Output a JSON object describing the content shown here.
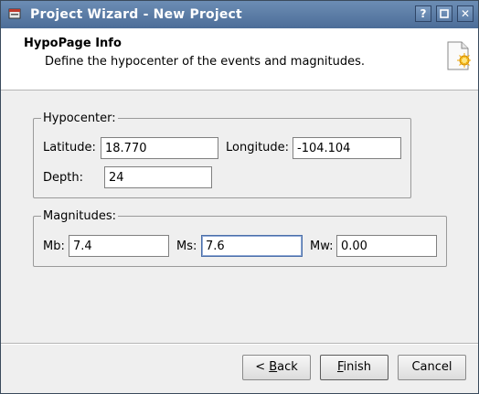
{
  "window": {
    "title": "Project Wizard - New Project",
    "help_btn": "?",
    "close_btn": "✕"
  },
  "header": {
    "title": "HypoPage Info",
    "subtitle": "Define the hypocenter of the events and magnitudes."
  },
  "hypocenter": {
    "legend": "Hypocenter:",
    "latitude_label": "Latitude:",
    "latitude_value": "18.770",
    "longitude_label": "Longitude:",
    "longitude_value": "-104.104",
    "depth_label": "Depth:",
    "depth_value": "24"
  },
  "magnitudes": {
    "legend": "Magnitudes:",
    "mb_label": "Mb:",
    "mb_value": "7.4",
    "ms_label": "Ms:",
    "ms_value": "7.6",
    "mw_label": "Mw:",
    "mw_value": "0.00"
  },
  "buttons": {
    "back_prefix": "< ",
    "back_mnemonic": "B",
    "back_rest": "ack",
    "finish_mnemonic": "F",
    "finish_rest": "inish",
    "cancel": "Cancel"
  },
  "icons": [
    "app-icon",
    "help-icon",
    "maximize-icon",
    "close-icon",
    "new-document-icon"
  ]
}
